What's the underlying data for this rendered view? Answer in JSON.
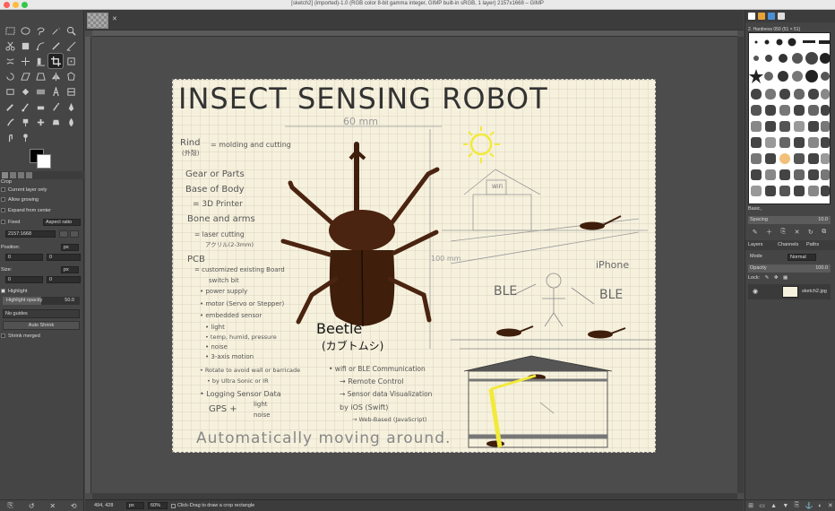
{
  "window": {
    "title": "[sketch2] (imported)-1.0 (RGB color 8-bit gamma integer, GIMP built-in sRGB, 1 layer) 2157x1668 – GIMP"
  },
  "tool_options": {
    "title": "Crop",
    "current_layer_only": "Current layer only",
    "allow_growing": "Allow growing",
    "expand_from_center": "Expand from center",
    "fixed_label": "Fixed",
    "fixed_value": "Aspect ratio",
    "ratio_value": "2157:1668",
    "position_label": "Position:",
    "position_unit": "px",
    "position_x": "0",
    "position_y": "0",
    "size_label": "Size:",
    "size_unit": "px",
    "size_w": "0",
    "size_h": "0",
    "highlight_label": "Highlight",
    "highlight_opacity_label": "Highlight opacity",
    "highlight_opacity_value": "50.0",
    "highlight_opacity_fraction": 0.5,
    "guides_value": "No guides",
    "auto_shrink": "Auto Shrink",
    "shrink_merged": "Shrink merged"
  },
  "status_bar": {
    "coords": "494, 428",
    "unit": "px",
    "zoom": "60%",
    "message": "Click-Drag to draw a crop rectangle"
  },
  "sketch": {
    "title": "INSECT SENSING ROBOT",
    "width_note": "60 mm",
    "height_note": "100 mm",
    "rind": "Rind",
    "rind_jp": "(外殻)",
    "rind_note": "= molding and cutting",
    "gear": "Gear or Parts",
    "base": "Base of Body",
    "printer": "= 3D Printer",
    "bone": "Bone and arms",
    "laser": "= laser cutting",
    "acrylic": "アクリル(2-3mm)",
    "pcb": "PCB",
    "pcb_note": "= customized existing Board",
    "switch": "switch bit",
    "power": "• power supply",
    "motor": "• motor (Servo or Stepper)",
    "embedded": "• embedded sensor",
    "light": "• light",
    "temp": "• temp, humid, pressure",
    "noise": "• noise",
    "axis": "• 3-axis motion",
    "rotate": "• Rotate to avoid wall or barricade",
    "ultra": "• by Ultra Sonic or IR",
    "logging": "• Logging Sensor Data",
    "gps": "GPS +",
    "gps_light": "light",
    "gps_noise": "noise",
    "wifi": "• wifi or BLE Communication",
    "remote": "→ Remote Control",
    "visual": "→ Sensor data Visualization",
    "ios": "by iOS (Swift)",
    "web": "→ Web-Based (JavaScript)",
    "beetle": "Beetle",
    "beetle_jp": "(カブトムシ)",
    "wifi_label": "WiFi",
    "ble1": "BLE",
    "ble2": "BLE",
    "iphone": "iPhone",
    "footer": "Automatically moving around."
  },
  "right_dock": {
    "brush_name": "2. Hardness 050 (51 × 51)",
    "preset": "Basic,",
    "spacing_label": "Spacing",
    "spacing_value": "10.0",
    "tab_layers": "Layers",
    "tab_channels": "Channels",
    "tab_paths": "Paths",
    "mode_label": "Mode",
    "mode_value": "Normal",
    "opacity_label": "Opacity",
    "opacity_value": "100.0",
    "lock_label": "Lock:",
    "layer_name": "sketch2.jpg"
  },
  "colors": {
    "accent": "#dcdcdc",
    "paper": "#f6f1dd",
    "beetle": "#3f1e0c",
    "sun": "#f2ea3a"
  }
}
